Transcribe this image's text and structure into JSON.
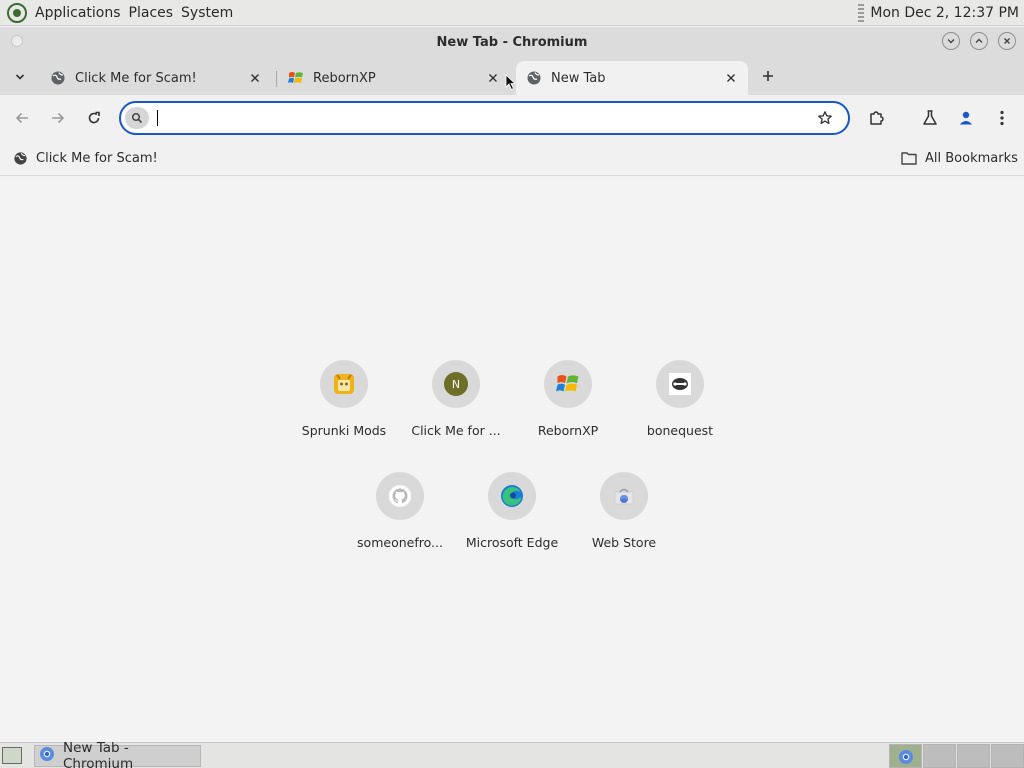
{
  "top_panel": {
    "menus": [
      "Applications",
      "Places",
      "System"
    ],
    "clock": "Mon Dec  2, 12:37 PM"
  },
  "window": {
    "title": "New Tab - Chromium"
  },
  "tabs": [
    {
      "label": "Click Me for Scam!",
      "favicon": "globe-icon"
    },
    {
      "label": "RebornXP",
      "favicon": "windows-xp-logo-icon"
    },
    {
      "label": "New Tab",
      "favicon": "globe-icon",
      "active": true
    }
  ],
  "toolbar": {
    "omnibox_value": "",
    "omnibox_placeholder": ""
  },
  "bookmarks_bar": {
    "items": [
      {
        "label": "Click Me for Scam!",
        "icon": "globe-icon"
      }
    ],
    "all_bookmarks_label": "All Bookmarks"
  },
  "shortcuts": [
    {
      "label": "Sprunki Mods",
      "icon": "sprunki-icon"
    },
    {
      "label": "Click Me for ...",
      "icon": "letter-n-icon",
      "letter": "N"
    },
    {
      "label": "RebornXP",
      "icon": "windows-xp-logo-icon"
    },
    {
      "label": "bonequest",
      "icon": "bonequest-icon"
    },
    {
      "label": "someonefro...",
      "icon": "github-icon"
    },
    {
      "label": "Microsoft Edge",
      "icon": "edge-icon"
    },
    {
      "label": "Web Store",
      "icon": "web-store-icon"
    }
  ],
  "taskbar": {
    "task_label": "New Tab - Chromium"
  },
  "colors": {
    "omnibox_border": "#1a57c2",
    "profile_icon": "#1a57c2"
  }
}
